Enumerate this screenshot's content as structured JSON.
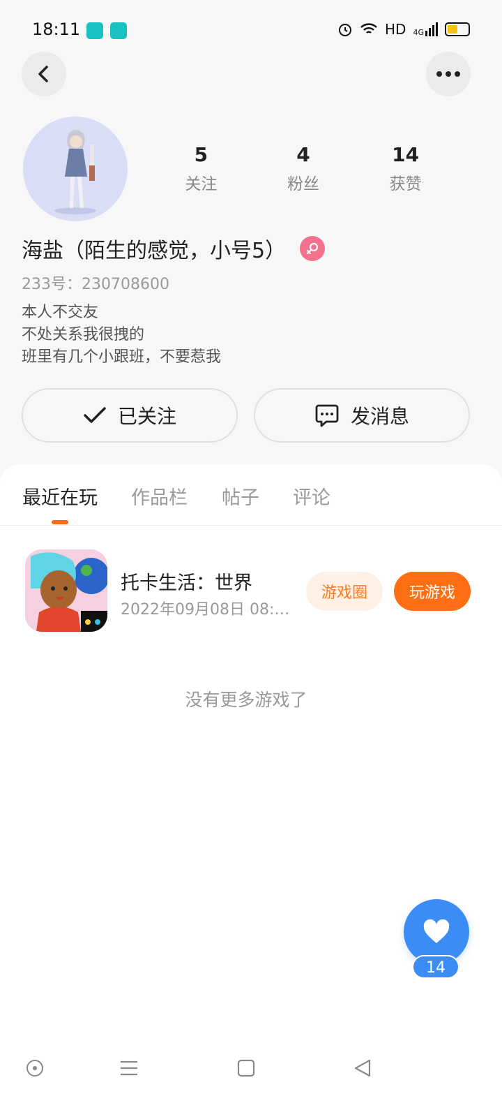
{
  "status_bar": {
    "time": "18:11",
    "network_label": "HD",
    "signal_label": "4G"
  },
  "top_bar": {
    "back_icon": "chevron-left-icon",
    "more_icon": "more-horizontal-icon"
  },
  "profile": {
    "name": "海盐（陌生的感觉，小号5）",
    "gender": "female",
    "uid": "233号：230708600",
    "bio": [
      "本人不交友",
      "不处关系我很拽的",
      "班里有几个小跟班，不要惹我"
    ],
    "stats": [
      {
        "value": "5",
        "label": "关注"
      },
      {
        "value": "4",
        "label": "粉丝"
      },
      {
        "value": "14",
        "label": "获赞"
      }
    ]
  },
  "actions": {
    "follow_label": "已关注",
    "message_label": "发消息"
  },
  "tabs": [
    {
      "label": "最近在玩",
      "active": true
    },
    {
      "label": "作品栏",
      "active": false
    },
    {
      "label": "帖子",
      "active": false
    },
    {
      "label": "评论",
      "active": false
    }
  ],
  "games": [
    {
      "name": "托卡生活：世界",
      "last_played": "2022年09月08日 08:1...",
      "circle_label": "游戏圈",
      "play_label": "玩游戏"
    }
  ],
  "empty_text": "没有更多游戏了",
  "like": {
    "count": "14"
  },
  "colors": {
    "accent": "#ff6e12",
    "like_blue": "#3b8cf5",
    "gender_pink": "#f3718d"
  }
}
